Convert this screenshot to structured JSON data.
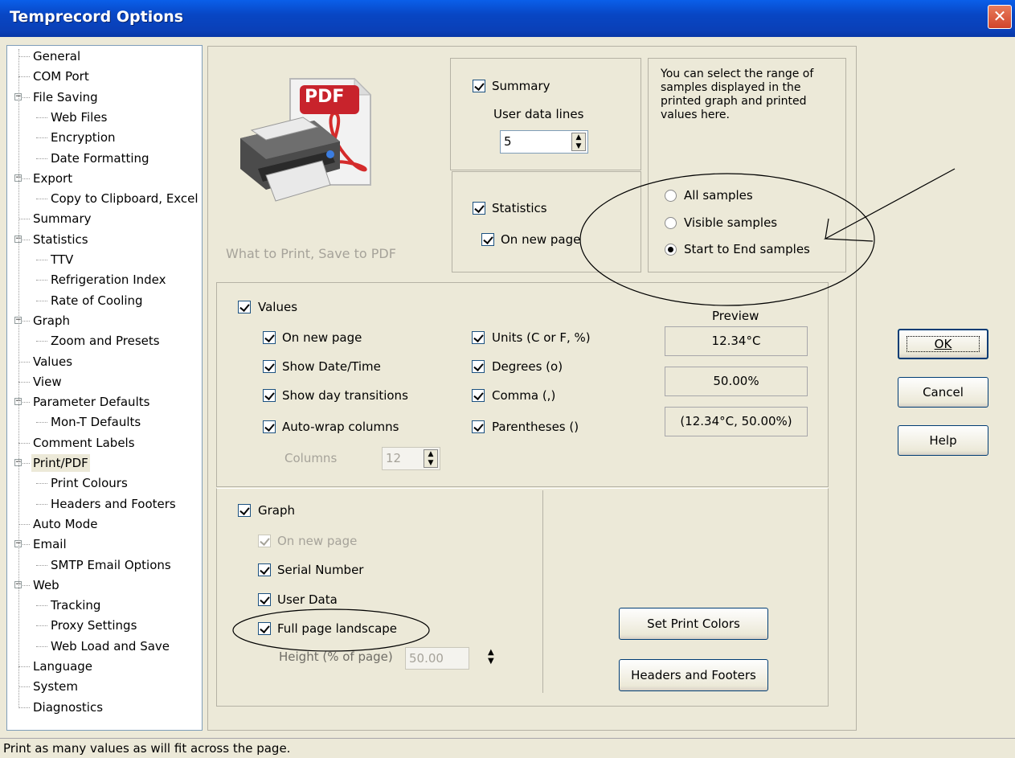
{
  "window": {
    "title": "Temprecord Options",
    "close_label": "✕"
  },
  "tree": {
    "items": [
      {
        "label": "General"
      },
      {
        "label": "COM Port"
      },
      {
        "label": "File Saving"
      },
      {
        "label": "Web Files"
      },
      {
        "label": "Encryption"
      },
      {
        "label": "Date Formatting"
      },
      {
        "label": "Export"
      },
      {
        "label": "Copy to Clipboard, Excel"
      },
      {
        "label": "Summary"
      },
      {
        "label": "Statistics"
      },
      {
        "label": "TTV"
      },
      {
        "label": "Refrigeration Index"
      },
      {
        "label": "Rate of Cooling"
      },
      {
        "label": "Graph"
      },
      {
        "label": "Zoom and Presets"
      },
      {
        "label": "Values"
      },
      {
        "label": "View"
      },
      {
        "label": "Parameter Defaults"
      },
      {
        "label": "Mon-T Defaults"
      },
      {
        "label": "Comment Labels"
      },
      {
        "label": "Print/PDF"
      },
      {
        "label": "Print Colours"
      },
      {
        "label": "Headers and Footers"
      },
      {
        "label": "Auto Mode"
      },
      {
        "label": "Email"
      },
      {
        "label": "SMTP Email Options"
      },
      {
        "label": "Web"
      },
      {
        "label": "Tracking"
      },
      {
        "label": "Proxy Settings"
      },
      {
        "label": "Web Load and Save"
      },
      {
        "label": "Language"
      },
      {
        "label": "System"
      },
      {
        "label": "Diagnostics"
      }
    ],
    "selected": "Print/PDF"
  },
  "header": {
    "pdf_badge": "PDF",
    "caption": "What to Print, Save to PDF"
  },
  "summary_group": {
    "summary_label": "Summary",
    "summary_checked": true,
    "user_data_lines_label": "User data lines",
    "user_data_lines_value": "5",
    "statistics_label": "Statistics",
    "statistics_checked": true,
    "stats_new_page_label": "On new page",
    "stats_new_page_checked": true
  },
  "range_group": {
    "description": "You can select the range of samples displayed in the printed graph and printed values here.",
    "options": [
      "All samples",
      "Visible samples",
      "Start to End samples"
    ],
    "selected": "Start to End samples"
  },
  "values_group": {
    "values_label": "Values",
    "on_new_page_label": "On new page",
    "show_datetime_label": "Show Date/Time",
    "show_day_transitions_label": "Show day transitions",
    "auto_wrap_label": "Auto-wrap columns",
    "columns_label": "Columns",
    "columns_value": "12",
    "units_label": "Units (C or F, %)",
    "degrees_label": "Degrees (o)",
    "comma_label": "Comma (,)",
    "parentheses_label": "Parentheses ()",
    "preview_title": "Preview",
    "preview_values": [
      "12.34°C",
      "50.00%",
      "(12.34°C, 50.00%)"
    ]
  },
  "graph_group": {
    "graph_label": "Graph",
    "on_new_page_label": "On new page",
    "serial_number_label": "Serial Number",
    "user_data_label": "User Data",
    "full_page_landscape_label": "Full page landscape",
    "height_label": "Height (% of page)",
    "height_value": "50.00",
    "set_print_colors_label": "Set Print Colors",
    "headers_footers_label": "Headers and Footers"
  },
  "dialog_buttons": {
    "ok_label": "OK",
    "cancel_label": "Cancel",
    "help_label": "Help"
  },
  "status_bar": {
    "text": "Print as many values as will fit across the page."
  }
}
